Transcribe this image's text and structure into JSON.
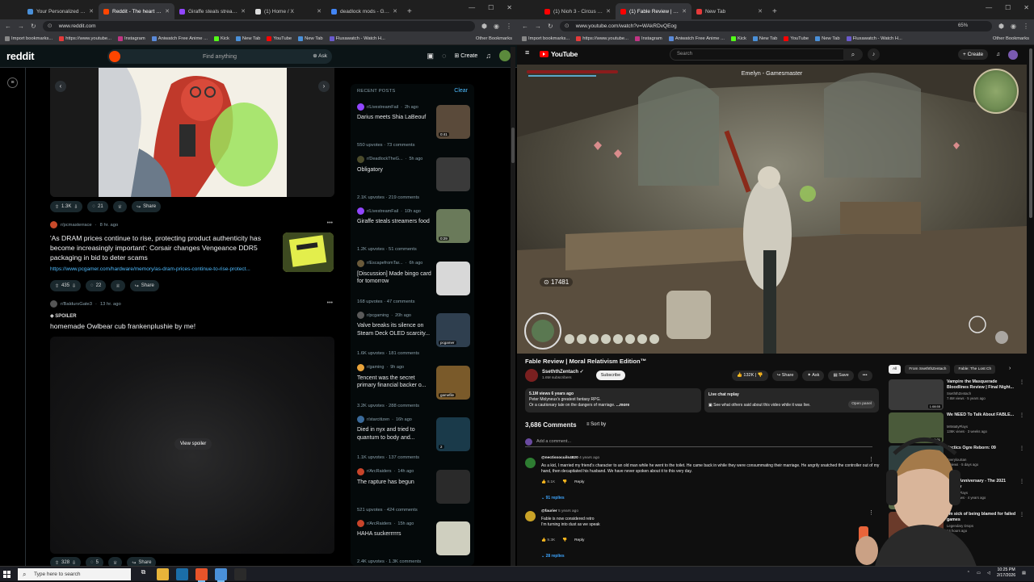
{
  "left_browser": {
    "tabs": [
      {
        "label": "Your Personalized Reco",
        "color": "#4a90d9",
        "active": false
      },
      {
        "label": "Reddit - The heart of th",
        "color": "#ff4500",
        "active": true
      },
      {
        "label": "Giraffe steals streamers",
        "color": "#9146ff",
        "active": false
      },
      {
        "label": "(1) Home / X",
        "color": "#dddddd",
        "active": false
      },
      {
        "label": "deadlock mods - Google",
        "color": "#4285f4",
        "active": false
      }
    ],
    "url": "www.reddit.com",
    "bookmarks": [
      "Import bookmarks...",
      "https://www.youtube...",
      "Instagram",
      "Aniwatch Free Anime ...",
      "Kick",
      "New Tab",
      "YouTube",
      "New Tab",
      "Fluxawatch - Watch H..."
    ],
    "other_bookmarks": "Other Bookmarks"
  },
  "reddit": {
    "logo": "reddit",
    "search_placeholder": "Find anything",
    "ask_label": "Ask",
    "create_label": "Create",
    "post1": {
      "upvotes": "1.3K",
      "comments": "21",
      "share": "Share"
    },
    "post2": {
      "subreddit": "r/pcmasterrace",
      "age": "8 hr. ago",
      "title": "'As DRAM prices continue to rise, protecting product authenticity has become increasingly important': Corsair changes Vengeance DDR5 packaging in bid to deter scams",
      "link": "https://www.pcgamer.com/hardware/memory/as-dram-prices-continue-to-rise-protect...",
      "upvotes": "435",
      "comments": "22",
      "share": "Share"
    },
    "post3": {
      "subreddit": "r/BaldursGate3",
      "age": "13 hr. ago",
      "spoiler": "SPOILER",
      "title": "homemade Owlbear cub frankenplushie by me!",
      "view_spoiler": "View spoiler",
      "upvotes": "328",
      "comments": "5",
      "share": "Share"
    },
    "recent": {
      "header": "RECENT POSTS",
      "clear": "Clear",
      "items": [
        {
          "sub": "r/LivestreamFail",
          "age": "2h ago",
          "title": "Darius meets Shia LaBeouf",
          "meta": "550 upvotes · 73 comments",
          "icon": "#9146ff",
          "thumb": "#5a4a3a",
          "badge": "0:41"
        },
        {
          "sub": "r/DeadlockTheG...",
          "age": "5h ago",
          "title": "Obligatory",
          "meta": "2.1K upvotes · 219 comments",
          "icon": "#4b4b2b",
          "thumb": "#3a3a3a",
          "badge": ""
        },
        {
          "sub": "r/LivestreamFail",
          "age": "10h ago",
          "title": "Giraffe steals streamers food",
          "meta": "1.2K upvotes · 51 comments",
          "icon": "#9146ff",
          "thumb": "#6a7a5a",
          "badge": "0:29"
        },
        {
          "sub": "r/EscapefromTar...",
          "age": "6h ago",
          "title": "[Discussion] Made bingo card for tomorrow",
          "meta": "168 upvotes · 47 comments",
          "icon": "#6a5a3a",
          "thumb": "#d8d8d8",
          "badge": ""
        },
        {
          "sub": "r/pcgaming",
          "age": "20h ago",
          "title": "Valve breaks its silence on Steam Deck OLED scarcity...",
          "meta": "1.6K upvotes · 181 comments",
          "icon": "#5a5a5a",
          "thumb": "#2f3f4f",
          "badge": "pcgamer"
        },
        {
          "sub": "r/gaming",
          "age": "9h ago",
          "title": "Tencent was the secret primary financial backer o...",
          "meta": "3.2K upvotes · 288 comments",
          "icon": "#e8a33a",
          "thumb": "#7a5a2a",
          "badge": "gamefile"
        },
        {
          "sub": "r/starcitizen",
          "age": "16h ago",
          "title": "Died in nyx and tried to quantum to body and...",
          "meta": "1.1K upvotes · 137 comments",
          "icon": "#3a6a9a",
          "thumb": "#1a3a4a",
          "badge": "2"
        },
        {
          "sub": "r/ArcRaiders",
          "age": "14h ago",
          "title": "The rapture has begun",
          "meta": "521 upvotes · 424 comments",
          "icon": "#c8442a",
          "thumb": "#2a2a2a",
          "badge": ""
        },
        {
          "sub": "r/ArcRaiders",
          "age": "15h ago",
          "title": "HAHA suckerrrrrs",
          "meta": "2.4K upvotes · 1.3K comments",
          "icon": "#c8442a",
          "thumb": "#cfcfbf",
          "badge": ""
        }
      ]
    }
  },
  "right_browser": {
    "tabs": [
      {
        "label": "(1) Nioh 3 - Circus of Grandmas",
        "color": "#ff0000",
        "active": false
      },
      {
        "label": "(1) Fable Review | Moral Re",
        "color": "#ff0000",
        "active": true
      },
      {
        "label": "New Tab",
        "color": "#e53a3a",
        "active": false
      }
    ],
    "url": "www.youtube.com/watch?v=WAkRDvQEog",
    "zoom": "65%",
    "bookmarks": [
      "Import bookmarks...",
      "https://www.youtube...",
      "Instagram",
      "Aniwatch Free Anime ...",
      "Kick",
      "New Tab",
      "YouTube",
      "New Tab",
      "Fluxawatch - Watch H..."
    ],
    "other_bookmarks": "Other Bookmarks"
  },
  "youtube": {
    "logo": "YouTube",
    "search_placeholder": "Search",
    "create_label": "Create",
    "player": {
      "overlay_title": "Emelyn - Gamesmaster",
      "gold": "17481"
    },
    "video_title": "Fable Review | Moral Relativism Edition™",
    "channel": "SseththZentach",
    "subscribers": "1.6M subscribers",
    "subscribe_label": "Subscribe",
    "likes": "132K",
    "share": "Share",
    "ask": "Ask",
    "save": "Save",
    "description": {
      "stats": "5.1M views  6 years ago",
      "line1": "Peter Molyneux's greatest fantasy RPG.",
      "line2": "Or a cautionary tale on the dangers of marriage.",
      "more": "...more"
    },
    "live_chat": {
      "title": "Live chat replay",
      "text": "See what others said about this video while it was live.",
      "open": "Open panel"
    },
    "comment_count": "3,686 Comments",
    "sort_by": "Sort by",
    "add_comment": "Add a comment...",
    "comments": [
      {
        "author": "@nectissocuils4820",
        "age": "4 years ago",
        "text": "As a kid, I married my friend's character to an old man while he went to the toilet. He came back in while they were consummating their marriage. He angrily snatched the controller out of my hand, then decapitated his husband. We have never spoken about it to this very day.",
        "likes": "8.1K",
        "reply": "Reply",
        "replies": "91 replies",
        "avatar": "#2e7d32"
      },
      {
        "author": "@faurier",
        "age": "5 years ago",
        "text": "Fable is now considered retro\nI'm turning into dust as we speak",
        "likes": "9.3K",
        "reply": "Reply",
        "replies": "28 replies",
        "avatar": "#c9a227"
      }
    ],
    "chips": [
      "All",
      "From SseththZentach",
      "Fable: The Lost Ch"
    ],
    "recommended": [
      {
        "title": "Vampire the Masquerade Bloodlines Review | Final Night...",
        "channel": "SseththZentach",
        "meta": "7.6M views · 5 years ago",
        "dur": "1:08:55",
        "thumb": "#3a3a3a"
      },
      {
        "title": "We NEED To Talk About FABLE...",
        "channel": "MrMattyPlays",
        "meta": "136K views · 3 weeks ago",
        "dur": "20:21",
        "thumb": "#4a5a3a"
      },
      {
        "title": "Tactics Ogre Reborn: 09",
        "channel": "EverylouSan",
        "meta": "2 views · 5 days ago",
        "dur": "",
        "thumb": "#2f3f3f"
      },
      {
        "title": "Fable Anniversary - The 2021 Review",
        "channel": "MrMattyPlays",
        "meta": "148K views · 4 years ago",
        "dur": "",
        "thumb": "#5a6a4a"
      },
      {
        "title": "I'm sick of being blamed for failed games",
        "channel": "Legendary Drops",
        "meta": "14 hours ago",
        "dur": "",
        "thumb": "#6a3a2a"
      }
    ]
  },
  "taskbar": {
    "search_placeholder": "Type here to search",
    "time": "10:25 PM",
    "date": "2/17/2026"
  },
  "colors": {
    "reddit_orange": "#ff4500",
    "youtube_red": "#ff0000",
    "link_blue": "#4fbcff"
  }
}
